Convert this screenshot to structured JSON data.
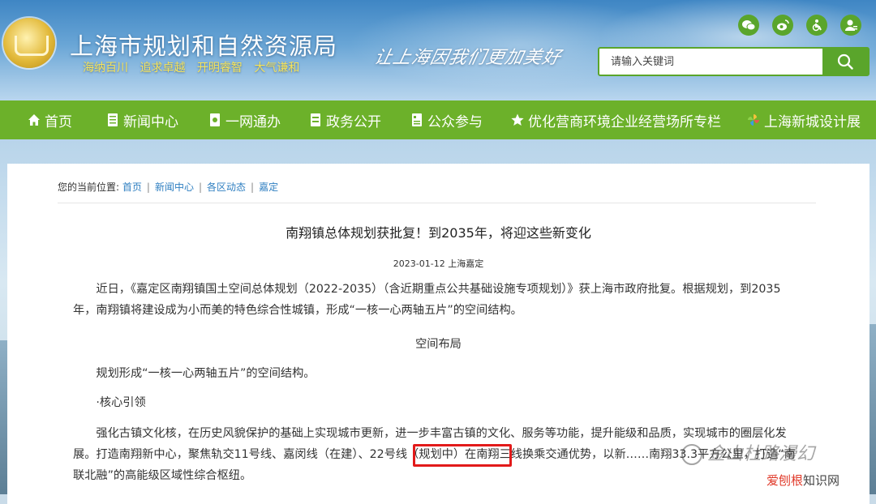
{
  "header": {
    "site_title": "上海市规划和自然资源局",
    "slogan": "海纳百川  追求卓越  开明睿智  大气谦和",
    "calligraphy": "让上海因我们更加美好",
    "search": {
      "placeholder": "请输入关键词"
    },
    "top_icons": [
      "wechat-icon",
      "weibo-icon",
      "accessibility-icon",
      "user-icon"
    ]
  },
  "nav": {
    "items": [
      {
        "label": "首页",
        "icon": "home-icon"
      },
      {
        "label": "新闻中心",
        "icon": "news-icon"
      },
      {
        "label": "一网通办",
        "icon": "service-icon"
      },
      {
        "label": "政务公开",
        "icon": "document-icon"
      },
      {
        "label": "公众参与",
        "icon": "participation-icon"
      },
      {
        "label": "优化营商环境企业经营场所专栏",
        "icon": "star-icon"
      },
      {
        "label": "上海新城设计展",
        "icon": "pinwheel-icon"
      }
    ]
  },
  "breadcrumb": {
    "prefix": "您的当前位置:",
    "items": [
      "首页",
      "新闻中心",
      "各区动态",
      "嘉定"
    ]
  },
  "article": {
    "title": "南翔镇总体规划获批复！到2035年，将迎这些新变化",
    "meta": "2023-01-12 上海嘉定",
    "para1": "近日，《嘉定区南翔镇国土空间总体规划（2022-2035）（含近期重点公共基础设施专项规划）》获上海市政府批复。根据规划，到2035年，南翔镇将建设成为小而美的特色综合性城镇，形成“一核一心两轴五片”的空间结构。",
    "section_heading": "空间布局",
    "para2": "规划形成“一核一心两轴五片”的空间结构。",
    "para3": "·核心引领",
    "para4": "强化古镇文化核，在历史风貌保护的基础上实现城市更新，进一步丰富古镇的文化、服务等功能，提升能级和品质，实现城市的圈层化发展。打造南翔新中心，聚焦轨交11号线、嘉闵线（在建）、22号线（规划中）在南翔三线换乘交通优势，以新……南翔33.3平方公里，打造“南联北融”的高能级区域性综合枢纽。"
  },
  "overlays": {
    "watermark": "金山杜路漫幻",
    "badge_red": "爱刨根",
    "badge_gray": "知识网"
  },
  "colors": {
    "nav_green": "#6cb12a",
    "link_blue": "#2f7fc1",
    "highlight_red": "#e21a1a"
  }
}
